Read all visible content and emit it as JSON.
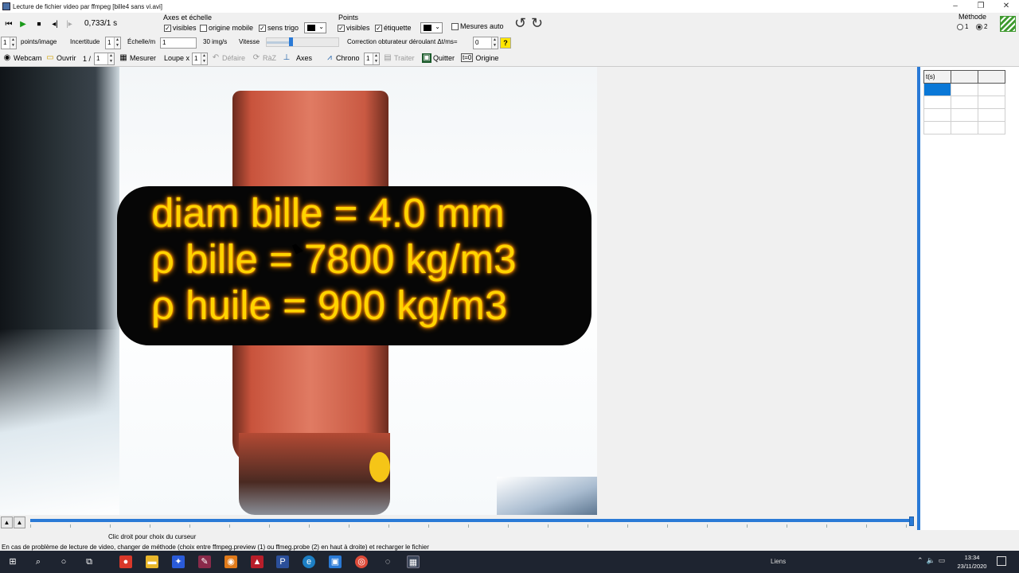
{
  "window": {
    "title": "Lecture de fichier video par ffmpeg [bille4 sans vi.avi]",
    "controls": [
      "–",
      "❐",
      "✕"
    ]
  },
  "player": {
    "time_readout": "0,733/1 s",
    "buttons": [
      "first-frame",
      "play",
      "stop",
      "prev-frame",
      "next-frame"
    ]
  },
  "axes_group": {
    "title": "Axes et échelle",
    "visibles": {
      "label": "visibles",
      "checked": true
    },
    "origine_mobile": {
      "label": "origine mobile",
      "checked": false
    },
    "sens_trigo": {
      "label": "sens trigo",
      "checked": true
    },
    "color": "#000000"
  },
  "points_group": {
    "title": "Points",
    "visibles": {
      "label": "visibles",
      "checked": true
    },
    "etiquette": {
      "label": "étiquette",
      "checked": true
    },
    "color": "#000000"
  },
  "mesures_auto": {
    "label": "Mesures auto",
    "checked": false
  },
  "methode": {
    "title": "Méthode",
    "options": [
      "1",
      "2"
    ],
    "selected": "2"
  },
  "row2": {
    "points_per_image_value": "1",
    "points_per_image_label": "points/image",
    "incertitude_label": "Incertitude",
    "incertitude_value": "1",
    "echelle_label": "Échelle/m",
    "echelle_value": "1",
    "fps_label": "30 img/s",
    "vitesse_label": "Vitesse",
    "vitesse_level": 0.33,
    "correction_label": "Correction obturateur déroulant Δt/ms=",
    "correction_value": "0",
    "help": "?"
  },
  "row3": {
    "webcam": "Webcam",
    "ouvrir": "Ouvrir",
    "frame_prefix": "1 /",
    "frame_value": "1",
    "mesurer": "Mesurer",
    "loupe": "Loupe x",
    "loupe_value": "1",
    "defaire": "Défaire",
    "raz": "RàZ",
    "axes": "Axes",
    "chrono": "Chrono",
    "chrono_value": "1",
    "traiter": "Traiter",
    "quitter": "Quitter",
    "t0_icon": "t=0",
    "origine": "Origine"
  },
  "video_overlay": {
    "line1": "diam bille = 4.0 mm",
    "line2": "ρ  bille = 7800 kg/m3",
    "line3": "ρ huile = 900 kg/m3"
  },
  "table": {
    "headers": [
      "t(s)",
      "",
      ""
    ],
    "rows": [
      [
        "",
        "",
        ""
      ],
      [
        "",
        "",
        ""
      ],
      [
        "",
        "",
        ""
      ],
      [
        "",
        "",
        ""
      ]
    ]
  },
  "slider": {
    "position": 0.733
  },
  "status": {
    "line1": "Clic droit pour choix du curseur",
    "line2": "En cas de problème de lecture de video, changer de méthode (choix entre ffmpeg.preview (1) ou ffmeg.probe (2) en haut à droite) et  recharger le fichier"
  },
  "taskbar": {
    "liens": "Liens",
    "time": "13:34",
    "date": "23/11/2020"
  }
}
